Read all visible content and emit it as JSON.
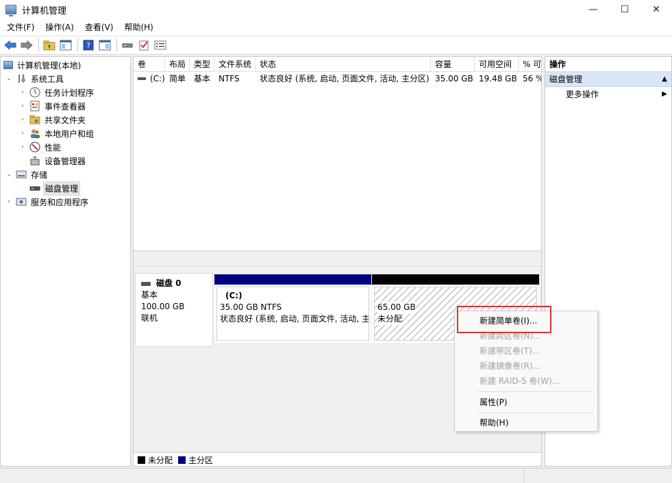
{
  "window": {
    "title": "计算机管理",
    "controls": [
      "—",
      "☐",
      "✕"
    ]
  },
  "menu": [
    "文件(F)",
    "操作(A)",
    "查看(V)",
    "帮助(H)"
  ],
  "tree": {
    "root": "计算机管理(本地)",
    "system_tools": "系统工具",
    "task_scheduler": "任务计划程序",
    "event_viewer": "事件查看器",
    "shared_folders": "共享文件夹",
    "local_users": "本地用户和组",
    "performance": "性能",
    "device_manager": "设备管理器",
    "storage": "存储",
    "disk_management": "磁盘管理",
    "services_apps": "服务和应用程序"
  },
  "volumes": {
    "columns": [
      "卷",
      "布局",
      "类型",
      "文件系统",
      "状态",
      "容量",
      "可用空间",
      "% 可"
    ],
    "rows": [
      {
        "volume": "(C:)",
        "layout": "简单",
        "type": "基本",
        "fs": "NTFS",
        "status": "状态良好 (系统, 启动, 页面文件, 活动, 主分区)",
        "capacity": "35.00 GB",
        "free": "19.48 GB",
        "pct": "56 %"
      }
    ]
  },
  "disk": {
    "name": "磁盘 0",
    "type": "基本",
    "size": "100.00 GB",
    "state": "联机",
    "partitions": [
      {
        "label": "(C:)",
        "size": "35.00 GB NTFS",
        "status": "状态良好 (系统, 启动, 页面文件, 活动, 主分区)",
        "color": "#00007f"
      },
      {
        "size": "65.00 GB",
        "status": "未分配",
        "color": "#000000"
      }
    ]
  },
  "legend": [
    {
      "label": "未分配",
      "color": "#000000"
    },
    {
      "label": "主分区",
      "color": "#00007f"
    }
  ],
  "actions": {
    "title": "操作",
    "section": "磁盘管理",
    "more": "更多操作"
  },
  "context_menu": {
    "new_simple": "新建简单卷(I)...",
    "new_spanned": "新建跨区卷(N)...",
    "new_striped": "新建带区卷(T)...",
    "new_mirrored": "新建镜像卷(R)...",
    "new_raid5": "新建 RAID-5 卷(W)...",
    "properties": "属性(P)",
    "help": "帮助(H)"
  },
  "colors": {
    "highlight": "#d9342b",
    "primary_partition": "#00007f",
    "unallocated": "#000000",
    "section_bg": "#d9e6f5"
  }
}
